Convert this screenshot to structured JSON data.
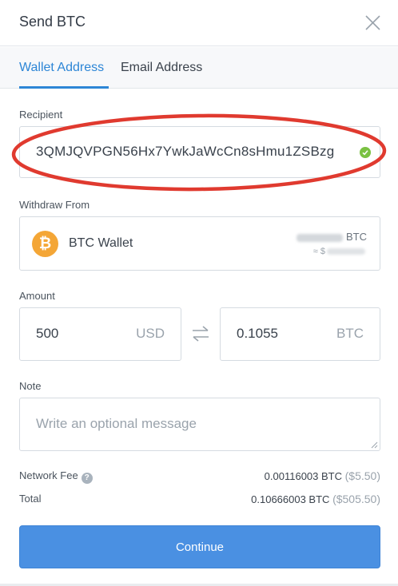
{
  "header": {
    "title": "Send BTC",
    "close_icon": "close-icon"
  },
  "tabs": [
    {
      "label": "Wallet Address",
      "active": true
    },
    {
      "label": "Email Address",
      "active": false
    }
  ],
  "recipient": {
    "label": "Recipient",
    "value": "3QMJQVPGN56Hx7YwkJaWcCn8sHmu1ZSBzg",
    "valid_icon": "check-circle-icon",
    "valid_color": "#7ac142",
    "highlight_color": "#e03a2f"
  },
  "withdraw": {
    "label": "Withdraw From",
    "wallet_name": "BTC Wallet",
    "coin_icon": "bitcoin-icon",
    "coin_symbol": "₿",
    "coin_color": "#f4a636",
    "balance_unit": "BTC",
    "fiat_prefix": "≈ $"
  },
  "amount": {
    "label": "Amount",
    "fiat_value": "500",
    "fiat_unit": "USD",
    "crypto_value": "0.1055",
    "crypto_unit": "BTC",
    "swap_icon": "swap-arrows-icon"
  },
  "note": {
    "label": "Note",
    "placeholder": "Write an optional message"
  },
  "fees": {
    "network_fee_label": "Network Fee",
    "network_fee_value": "0.00116003 BTC",
    "network_fee_fiat": "($5.50)",
    "total_label": "Total",
    "total_value": "0.10666003 BTC",
    "total_fiat": "($505.50)",
    "help_icon": "question-icon"
  },
  "actions": {
    "continue_label": "Continue",
    "accent_color": "#4a90e2"
  }
}
